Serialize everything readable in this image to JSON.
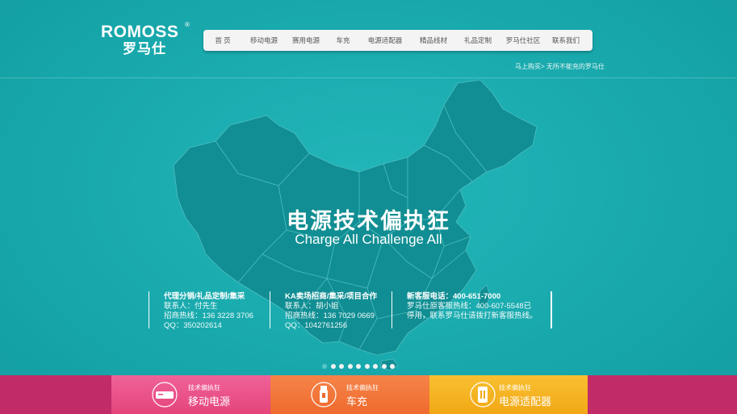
{
  "brand": {
    "logo_en": "ROMOSS",
    "logo_reg": "®",
    "logo_cn": "罗马仕"
  },
  "nav": {
    "items": [
      {
        "label": "首 页",
        "name": "nav-home"
      },
      {
        "label": "移动电源",
        "name": "nav-power-bank"
      },
      {
        "label": "赛用电源",
        "name": "nav-race-power"
      },
      {
        "label": "车充",
        "name": "nav-car-charger"
      },
      {
        "label": "电源适配器",
        "name": "nav-power-adapter"
      },
      {
        "label": "精品线材",
        "name": "nav-cables"
      },
      {
        "label": "礼品定制",
        "name": "nav-gift-custom"
      },
      {
        "label": "罗马仕社区",
        "name": "nav-community"
      },
      {
        "label": "联系我们",
        "name": "nav-contact"
      }
    ]
  },
  "breadcrumb": "马上购买> 无所不能充的罗马仕",
  "hero": {
    "title": "电源技术偏执狂",
    "subtitle": "Charge All Challenge All"
  },
  "contacts": [
    {
      "title": "代理分销/礼品定制/集采",
      "lines": [
        "联系人：付先生",
        "招商热线：136 3228 3706",
        "QQ：350202614"
      ]
    },
    {
      "title": "KA卖场招商/集采/项目合作",
      "lines": [
        "联系人：胡小姐",
        "招商热线：136 7029 0669",
        "QQ：1042761256"
      ]
    },
    {
      "title": "新客服电话：400-651-7000",
      "lines": [
        "罗马仕原客服热线：400-607-5548已",
        "停用，联系罗马仕请拨打新客服热线。"
      ]
    }
  ],
  "slider": {
    "count": 9,
    "active": 0
  },
  "product_cards": [
    {
      "tag": "技术偏执狂",
      "name": "移动电源",
      "icon": "power-bank-icon",
      "color": "#ec4f84"
    },
    {
      "tag": "技术偏执狂",
      "name": "车充",
      "icon": "car-charger-icon",
      "color": "#f3743b"
    },
    {
      "tag": "技术偏执狂",
      "name": "电源适配器",
      "icon": "adapter-icon",
      "color": "#f6b21c"
    }
  ],
  "colors": {
    "background": "#1aacb0",
    "map": "#118e93",
    "strip": "#c12b67",
    "nav_bg": "#f4f4f4"
  }
}
